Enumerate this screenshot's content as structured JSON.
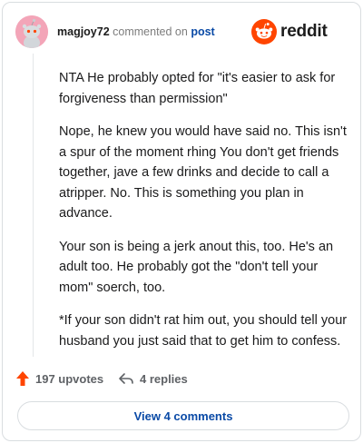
{
  "header": {
    "username": "magjoy72",
    "action_text": "commented on",
    "post_link": "post",
    "brand": "reddit"
  },
  "colors": {
    "brand": "#ff4500",
    "upvote": "#ff4500",
    "link": "#0a4aa6",
    "avatar_bg": "#f3a5b8"
  },
  "icons": {
    "avatar": "snoo-avatar-icon",
    "logo": "reddit-snoo-icon",
    "upvote": "upvote-arrow-icon",
    "reply": "reply-arrow-icon"
  },
  "comment": {
    "paragraphs": [
      "NTA He probably opted for \"it's easier to ask for forgiveness than permission\"",
      "Nope, he knew you would have said no. This isn't a spur of the moment rhing You don't get friends together, jave a few drinks and decide to call a atripper. No. This is something you plan in advance.",
      "Your son is being a jerk anout this, too. He's an adult too. He probably got the \"don't tell your mom\" soerch, too.",
      "*If your son didn't rat him out, you should tell your husband you just said that to get him to confess."
    ]
  },
  "actions": {
    "upvotes": "197 upvotes",
    "replies": "4 replies"
  },
  "footer": {
    "view_label": "View 4 comments"
  }
}
